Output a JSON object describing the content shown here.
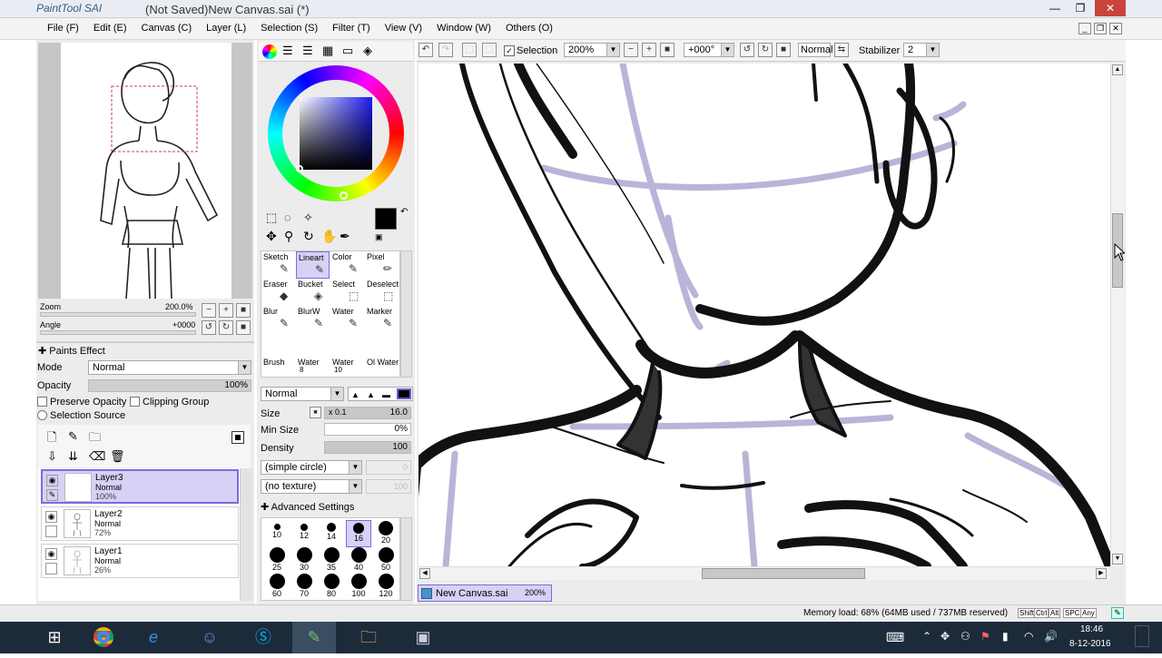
{
  "window": {
    "logo_text": "PaintTool SAI",
    "title": "(Not Saved)New Canvas.sai (*)",
    "minimize": "—",
    "restore": "❐",
    "close": "✕"
  },
  "menu": [
    "File (F)",
    "Edit (E)",
    "Canvas (C)",
    "Layer (L)",
    "Selection (S)",
    "Filter (T)",
    "View (V)",
    "Window (W)",
    "Others (O)"
  ],
  "navigator": {
    "zoom_label": "Zoom",
    "zoom_value": "200.0%",
    "angle_label": "Angle",
    "angle_value": "+0000"
  },
  "layer_panel": {
    "paint_effect": "Paints Effect",
    "mode_label": "Mode",
    "mode_value": "Normal",
    "opacity_label": "Opacity",
    "opacity_value": "100%",
    "preserve_opacity": "Preserve Opacity",
    "clipping_group": "Clipping Group",
    "selection_source": "Selection Source",
    "layers": [
      {
        "name": "Layer3",
        "mode": "Normal",
        "opacity": "100%"
      },
      {
        "name": "Layer2",
        "mode": "Normal",
        "opacity": "72%"
      },
      {
        "name": "Layer1",
        "mode": "Normal",
        "opacity": "26%"
      }
    ]
  },
  "tools": {
    "row1": [
      "Sketch",
      "Lineart",
      "Color",
      "Pixel"
    ],
    "row2": [
      "Eraser",
      "Bucket",
      "Select",
      "Deselect"
    ],
    "row3": [
      "Blur",
      "BlurW",
      "Water",
      "Marker"
    ],
    "row4": [
      "Brush",
      "Water",
      "Water",
      "Ol Water"
    ],
    "row4_sub": [
      "",
      "8",
      "10",
      ""
    ]
  },
  "brush_settings": {
    "blend_mode": "Normal",
    "size_label": "Size",
    "size_mult": "x 0.1",
    "size_value": "16.0",
    "min_size_label": "Min Size",
    "min_size_value": "0%",
    "density_label": "Density",
    "density_value": "100",
    "shape": "(simple circle)",
    "shape_value": "0",
    "texture": "(no texture)",
    "texture_value": "100",
    "advanced": "Advanced Settings",
    "brush_sizes": [
      "10",
      "12",
      "14",
      "16",
      "20",
      "25",
      "30",
      "35",
      "40",
      "50",
      "60",
      "70",
      "80",
      "100",
      "120"
    ]
  },
  "canvas_toolbar": {
    "selection_label": "Selection",
    "zoom": "200%",
    "angle": "+000°",
    "blend": "Normal",
    "stabilizer_label": "Stabilizer",
    "stabilizer_value": "2"
  },
  "canvas_tab": {
    "name": "New Canvas.sai",
    "zoom": "200%"
  },
  "status": {
    "memory": "Memory load: 68% (64MB used / 737MB reserved)",
    "keys": [
      "Shift",
      "Ctrl",
      "Alt",
      "SPC",
      "Any"
    ]
  },
  "taskbar": {
    "time": "18:46",
    "date": "8-12-2016"
  },
  "colors": {
    "title_bg": "#e9edf3",
    "panel_bg": "#ececec",
    "selection_highlight": "#d7d1f5",
    "taskbar_bg": "#1d2a3a",
    "ink": "#000000",
    "sketch_lavender": "#b9b4d8"
  }
}
